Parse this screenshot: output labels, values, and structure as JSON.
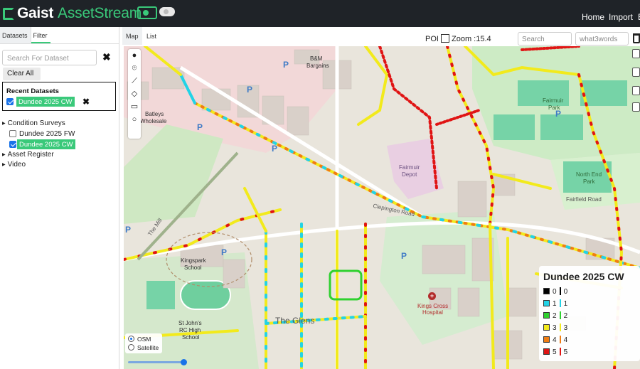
{
  "app": {
    "brand_first": "Gaist",
    "brand_second": "AssetStream"
  },
  "nav": {
    "home": "Home",
    "import": "Import",
    "more": "E"
  },
  "sidebar": {
    "tabs": [
      "Datasets",
      "Filter"
    ],
    "search_placeholder": "Search For Dataset",
    "clear_all": "Clear All",
    "recent_title": "Recent Datasets",
    "recent_item": "Dundee 2025 CW",
    "groups": {
      "condition_surveys": "Condition Surveys",
      "fw": "Dundee 2025 FW",
      "cw": "Dundee 2025 CW",
      "asset_register": "Asset Register",
      "video": "Video"
    }
  },
  "map": {
    "tabs": [
      "Map",
      "List"
    ],
    "poi_label": "POI",
    "zoom_label": "Zoom :15.4",
    "search_placeholder": "Search",
    "w3w_placeholder": "what3words",
    "layer_osm": "OSM",
    "layer_satellite": "Satellite",
    "labels": {
      "bm1": "B&M",
      "bm2": "Bargains",
      "batleys1": "Batleys",
      "batleys2": "Wholesale",
      "fairmuir_park1": "Fairmuir",
      "fairmuir_park2": "Park",
      "fairmuir_depot1": "Fairmuir",
      "fairmuir_depot2": "Depot",
      "north_end1": "North End",
      "north_end2": "Park",
      "fairfield": "Fairfield Road",
      "kingspark1": "Kingspark",
      "kingspark2": "School",
      "stjohns1": "St John's",
      "stjohns2": "RC High",
      "stjohns3": "School",
      "glens": "The Glens",
      "kings_cross1": "Kings Cross",
      "kings_cross2": "Hospital",
      "the_mill": "The Mill",
      "clepington": "Clepington Road"
    }
  },
  "legend": {
    "title": "Dundee 2025 CW",
    "items": [
      {
        "value": "0",
        "color": "#000000"
      },
      {
        "value": "1",
        "color": "#22d3e6"
      },
      {
        "value": "2",
        "color": "#2fd12f"
      },
      {
        "value": "3",
        "color": "#f2ea1c"
      },
      {
        "value": "4",
        "color": "#f07d12"
      },
      {
        "value": "5",
        "color": "#e01414"
      }
    ]
  },
  "colors": {
    "accent": "#3ac97a",
    "topbar": "#1f2328"
  }
}
